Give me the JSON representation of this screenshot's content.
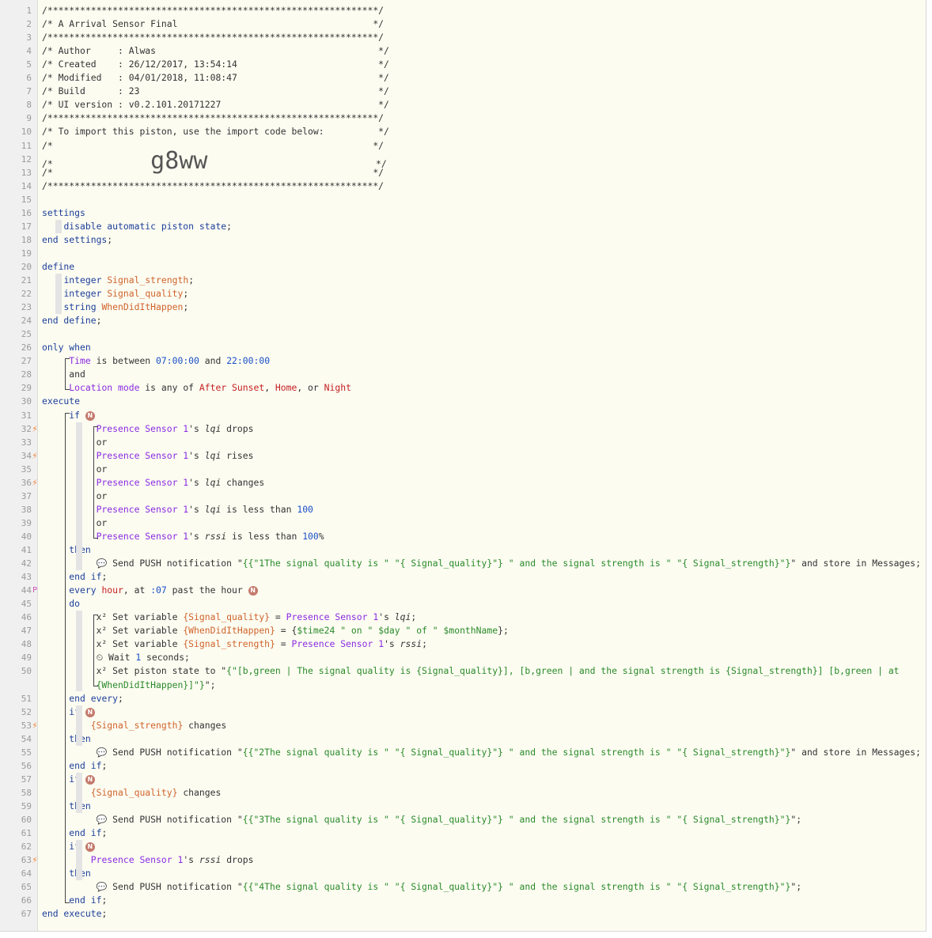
{
  "editor": {
    "lines": [
      {
        "n": "1",
        "segs": [
          [
            "c",
            "/*************************************************************/"
          ]
        ]
      },
      {
        "n": "2",
        "segs": [
          [
            "c",
            "/* A Arrival Sensor Final                                    */"
          ]
        ]
      },
      {
        "n": "3",
        "segs": [
          [
            "c",
            "/*************************************************************/"
          ]
        ]
      },
      {
        "n": "4",
        "segs": [
          [
            "c",
            "/* Author     : Alwas                                         */"
          ]
        ]
      },
      {
        "n": "5",
        "segs": [
          [
            "c",
            "/* Created    : 26/12/2017, 13:54:14                          */"
          ]
        ]
      },
      {
        "n": "6",
        "segs": [
          [
            "c",
            "/* Modified   : 04/01/2018, 11:08:47                          */"
          ]
        ]
      },
      {
        "n": "7",
        "segs": [
          [
            "c",
            "/* Build      : 23                                            */"
          ]
        ]
      },
      {
        "n": "8",
        "segs": [
          [
            "c",
            "/* UI version : v0.2.101.20171227                             */"
          ]
        ]
      },
      {
        "n": "9",
        "segs": [
          [
            "c",
            "/*************************************************************/"
          ]
        ]
      },
      {
        "n": "10",
        "segs": [
          [
            "c",
            "/* To import this piston, use the import code below:          */"
          ]
        ]
      },
      {
        "n": "11",
        "segs": [
          [
            "c",
            "/*                                                           */"
          ]
        ]
      },
      {
        "n": "12",
        "segs": [
          [
            "c",
            "/*                  "
          ],
          [
            "big",
            "g8ww"
          ],
          [
            "c",
            "                               */"
          ]
        ]
      },
      {
        "n": "13",
        "segs": [
          [
            "c",
            "/*                                                           */"
          ]
        ]
      },
      {
        "n": "14",
        "segs": [
          [
            "c",
            "/*************************************************************/"
          ]
        ]
      },
      {
        "n": "15",
        "segs": []
      },
      {
        "n": "16",
        "segs": [
          [
            "kw",
            "settings"
          ]
        ]
      },
      {
        "n": "17",
        "segs": [
          [
            "c",
            "    "
          ],
          [
            "kw",
            "disable automatic piston state"
          ],
          [
            "c",
            ";"
          ]
        ]
      },
      {
        "n": "18",
        "segs": [
          [
            "kw",
            "end settings"
          ],
          [
            "c",
            ";"
          ]
        ]
      },
      {
        "n": "19",
        "segs": []
      },
      {
        "n": "20",
        "segs": [
          [
            "kw",
            "define"
          ]
        ]
      },
      {
        "n": "21",
        "segs": [
          [
            "c",
            "    "
          ],
          [
            "kw",
            "integer "
          ],
          [
            "org",
            "Signal_strength"
          ],
          [
            "c",
            ";"
          ]
        ]
      },
      {
        "n": "22",
        "segs": [
          [
            "c",
            "    "
          ],
          [
            "kw",
            "integer "
          ],
          [
            "org",
            "Signal_quality"
          ],
          [
            "c",
            ";"
          ]
        ]
      },
      {
        "n": "23",
        "segs": [
          [
            "c",
            "    "
          ],
          [
            "kw",
            "string "
          ],
          [
            "org",
            "WhenDidItHappen"
          ],
          [
            "c",
            ";"
          ]
        ]
      },
      {
        "n": "24",
        "segs": [
          [
            "kw",
            "end define"
          ],
          [
            "c",
            ";"
          ]
        ]
      },
      {
        "n": "25",
        "segs": []
      },
      {
        "n": "26",
        "segs": [
          [
            "kw",
            "only when"
          ]
        ]
      },
      {
        "n": "27",
        "segs": [
          [
            "c",
            "     "
          ],
          [
            "pur",
            "Time"
          ],
          [
            "c",
            " is between "
          ],
          [
            "blue",
            "07:00:00"
          ],
          [
            "c",
            " and "
          ],
          [
            "blue",
            "22:00:00"
          ]
        ]
      },
      {
        "n": "28",
        "segs": [
          [
            "c",
            "     and"
          ]
        ]
      },
      {
        "n": "29",
        "segs": [
          [
            "c",
            "     "
          ],
          [
            "pur",
            "Location mode"
          ],
          [
            "c",
            " is any of "
          ],
          [
            "red",
            "After Sunset"
          ],
          [
            "c",
            ", "
          ],
          [
            "red",
            "Home"
          ],
          [
            "c",
            ", or "
          ],
          [
            "red",
            "Night"
          ]
        ]
      },
      {
        "n": "30",
        "segs": [
          [
            "kw",
            "execute"
          ]
        ]
      },
      {
        "n": "31",
        "segs": [
          [
            "c",
            "     "
          ],
          [
            "kw",
            "if "
          ],
          [
            "nicon",
            "N"
          ]
        ]
      },
      {
        "n": "32",
        "segs": [
          [
            "c",
            "          "
          ],
          [
            "pur",
            "Presence Sensor 1"
          ],
          [
            "c",
            "'s "
          ],
          [
            "it",
            "lqi"
          ],
          [
            "c",
            " drops"
          ]
        ]
      },
      {
        "n": "33",
        "segs": [
          [
            "c",
            "          or"
          ]
        ]
      },
      {
        "n": "34",
        "segs": [
          [
            "c",
            "          "
          ],
          [
            "pur",
            "Presence Sensor 1"
          ],
          [
            "c",
            "'s "
          ],
          [
            "it",
            "lqi"
          ],
          [
            "c",
            " rises"
          ]
        ]
      },
      {
        "n": "35",
        "segs": [
          [
            "c",
            "          or"
          ]
        ]
      },
      {
        "n": "36",
        "segs": [
          [
            "c",
            "          "
          ],
          [
            "pur",
            "Presence Sensor 1"
          ],
          [
            "c",
            "'s "
          ],
          [
            "it",
            "lqi"
          ],
          [
            "c",
            " changes"
          ]
        ]
      },
      {
        "n": "37",
        "segs": [
          [
            "c",
            "          or"
          ]
        ]
      },
      {
        "n": "38",
        "segs": [
          [
            "c",
            "          "
          ],
          [
            "pur",
            "Presence Sensor 1"
          ],
          [
            "c",
            "'s "
          ],
          [
            "it",
            "lqi"
          ],
          [
            "c",
            " is less than "
          ],
          [
            "blue",
            "100"
          ]
        ]
      },
      {
        "n": "39",
        "segs": [
          [
            "c",
            "          or"
          ]
        ]
      },
      {
        "n": "40",
        "segs": [
          [
            "c",
            "          "
          ],
          [
            "pur",
            "Presence Sensor 1"
          ],
          [
            "c",
            "'s "
          ],
          [
            "it",
            "rssi"
          ],
          [
            "c",
            " is less than "
          ],
          [
            "blue",
            "100"
          ],
          [
            "c",
            "%"
          ]
        ]
      },
      {
        "n": "41",
        "segs": [
          [
            "c",
            "     "
          ],
          [
            "kw",
            "then"
          ]
        ]
      },
      {
        "n": "42",
        "segs": [
          [
            "c",
            "          "
          ],
          [
            "ic",
            "💬"
          ],
          [
            "c",
            " Send PUSH notification \""
          ],
          [
            "grn",
            "{{\"1The signal quality is \" \"{ Signal_quality}\"} \" and the signal strength is \" \"{ Signal_strength}\"}"
          ],
          [
            "c",
            "\" and store in Messages;"
          ]
        ]
      },
      {
        "n": "43",
        "segs": [
          [
            "c",
            "     "
          ],
          [
            "kw",
            "end if"
          ],
          [
            "c",
            ";"
          ]
        ]
      },
      {
        "n": "44",
        "segs": [
          [
            "c",
            "     "
          ],
          [
            "kw",
            "every "
          ],
          [
            "red",
            "hour"
          ],
          [
            "c",
            ", at "
          ],
          [
            "blue",
            ":07"
          ],
          [
            "c",
            " past the hour "
          ],
          [
            "nicon",
            "N"
          ]
        ]
      },
      {
        "n": "45",
        "segs": [
          [
            "c",
            "     "
          ],
          [
            "kw",
            "do"
          ]
        ]
      },
      {
        "n": "46",
        "segs": [
          [
            "c",
            "          x² Set variable "
          ],
          [
            "org",
            "{Signal_quality}"
          ],
          [
            "c",
            " = "
          ],
          [
            "pur",
            "Presence Sensor 1"
          ],
          [
            "c",
            "'s "
          ],
          [
            "it",
            "lqi"
          ],
          [
            "c",
            ";"
          ]
        ]
      },
      {
        "n": "47",
        "segs": [
          [
            "c",
            "          x² Set variable "
          ],
          [
            "org",
            "{WhenDidItHappen}"
          ],
          [
            "c",
            " = {"
          ],
          [
            "grn",
            "$time24 \" on \" $day \" of \" $monthName"
          ],
          [
            "c",
            "};"
          ]
        ]
      },
      {
        "n": "48",
        "segs": [
          [
            "c",
            "          x² Set variable "
          ],
          [
            "org",
            "{Signal_strength}"
          ],
          [
            "c",
            " = "
          ],
          [
            "pur",
            "Presence Sensor 1"
          ],
          [
            "c",
            "'s "
          ],
          [
            "it",
            "rssi"
          ],
          [
            "c",
            ";"
          ]
        ]
      },
      {
        "n": "49",
        "segs": [
          [
            "c",
            "          "
          ],
          [
            "ic",
            "⏲"
          ],
          [
            "c",
            " Wait "
          ],
          [
            "blue",
            "1"
          ],
          [
            "c",
            " seconds;"
          ]
        ]
      },
      {
        "n": "50",
        "segs": [
          [
            "c",
            "          x² Set piston state to \""
          ],
          [
            "grn",
            "{\"[b,green | The signal quality is {Signal_quality}], [b,green | and the signal strength is {Signal_strength}] [b,green | at"
          ]
        ]
      },
      {
        "n": "",
        "segs": [
          [
            "c",
            "          "
          ],
          [
            "grn",
            "{WhenDidItHappen}]\"}"
          ],
          [
            "c",
            "\";"
          ]
        ]
      },
      {
        "n": "51",
        "segs": [
          [
            "c",
            "     "
          ],
          [
            "kw",
            "end every"
          ],
          [
            "c",
            ";"
          ]
        ]
      },
      {
        "n": "52",
        "segs": [
          [
            "c",
            "     "
          ],
          [
            "kw",
            "if "
          ],
          [
            "nicon",
            "N"
          ]
        ]
      },
      {
        "n": "53",
        "segs": [
          [
            "c",
            "         "
          ],
          [
            "org",
            "{Signal_strength}"
          ],
          [
            "c",
            " changes"
          ]
        ]
      },
      {
        "n": "54",
        "segs": [
          [
            "c",
            "     "
          ],
          [
            "kw",
            "then"
          ]
        ]
      },
      {
        "n": "55",
        "segs": [
          [
            "c",
            "          "
          ],
          [
            "ic",
            "💬"
          ],
          [
            "c",
            " Send PUSH notification \""
          ],
          [
            "grn",
            "{{\"2The signal quality is \" \"{ Signal_quality}\"} \" and the signal strength is \" \"{ Signal_strength}\"}"
          ],
          [
            "c",
            "\" and store in Messages;"
          ]
        ]
      },
      {
        "n": "56",
        "segs": [
          [
            "c",
            "     "
          ],
          [
            "kw",
            "end if"
          ],
          [
            "c",
            ";"
          ]
        ]
      },
      {
        "n": "57",
        "segs": [
          [
            "c",
            "     "
          ],
          [
            "kw",
            "if "
          ],
          [
            "nicon",
            "N"
          ]
        ]
      },
      {
        "n": "58",
        "segs": [
          [
            "c",
            "         "
          ],
          [
            "org",
            "{Signal_quality}"
          ],
          [
            "c",
            " changes"
          ]
        ]
      },
      {
        "n": "59",
        "segs": [
          [
            "c",
            "     "
          ],
          [
            "kw",
            "then"
          ]
        ]
      },
      {
        "n": "60",
        "segs": [
          [
            "c",
            "          "
          ],
          [
            "ic",
            "💬"
          ],
          [
            "c",
            " Send PUSH notification \""
          ],
          [
            "grn",
            "{{\"3The signal quality is \" \"{ Signal_quality}\"} \" and the signal strength is \" \"{ Signal_strength}\"}"
          ],
          [
            "c",
            "\";"
          ]
        ]
      },
      {
        "n": "61",
        "segs": [
          [
            "c",
            "     "
          ],
          [
            "kw",
            "end if"
          ],
          [
            "c",
            ";"
          ]
        ]
      },
      {
        "n": "62",
        "segs": [
          [
            "c",
            "     "
          ],
          [
            "kw",
            "if "
          ],
          [
            "nicon",
            "N"
          ]
        ]
      },
      {
        "n": "63",
        "segs": [
          [
            "c",
            "         "
          ],
          [
            "pur",
            "Presence Sensor 1"
          ],
          [
            "c",
            "'s "
          ],
          [
            "it",
            "rssi"
          ],
          [
            "c",
            " drops"
          ]
        ]
      },
      {
        "n": "64",
        "segs": [
          [
            "c",
            "     "
          ],
          [
            "kw",
            "then"
          ]
        ]
      },
      {
        "n": "65",
        "segs": [
          [
            "c",
            "          "
          ],
          [
            "ic",
            "💬"
          ],
          [
            "c",
            " Send PUSH notification \""
          ],
          [
            "grn",
            "{{\"4The signal quality is \" \"{ Signal_quality}\"} \" and the signal strength is \" \"{ Signal_strength}\"}"
          ],
          [
            "c",
            "\";"
          ]
        ]
      },
      {
        "n": "66",
        "segs": [
          [
            "c",
            "     "
          ],
          [
            "kw",
            "end if"
          ],
          [
            "c",
            ";"
          ]
        ]
      },
      {
        "n": "67",
        "segs": [
          [
            "kw",
            "end execute"
          ],
          [
            "c",
            ";"
          ]
        ]
      }
    ],
    "markers": {
      "32": "⚡",
      "34": "⚡",
      "36": "⚡",
      "44": "P",
      "53": "⚡",
      "63": "⚡"
    }
  }
}
